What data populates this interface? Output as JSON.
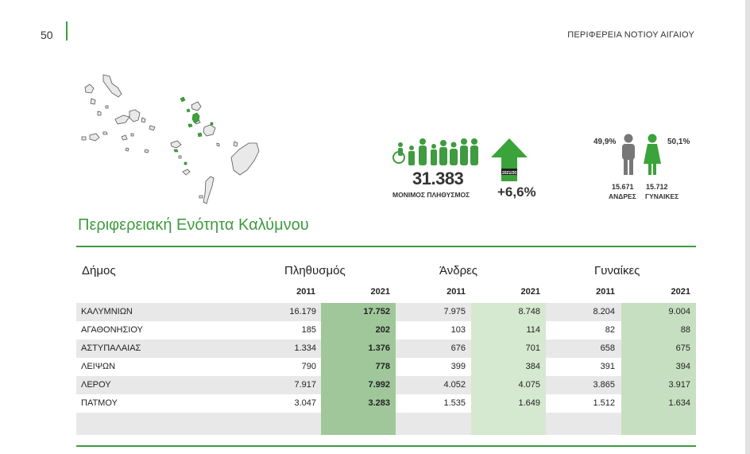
{
  "page": {
    "number": "50",
    "region": "ΠΕΡΙΦΕΡΕΙΑ ΝΟΤΙΟΥ ΑΙΓΑΙΟΥ"
  },
  "stats": {
    "total_population": "31.383",
    "total_label": "ΜΟΝΙΜΟΣ ΠΛΗΘΥΣΜΟΣ",
    "arrow_label": "2021/2011",
    "change": "+6,6%",
    "men_pct": "49,9%",
    "women_pct": "50,1%",
    "men_count": "15.671",
    "women_count": "15.712",
    "men_label": "ΑΝΔΡΕΣ",
    "women_label": "ΓΥΝΑΙΚΕΣ"
  },
  "unit_title": "Περιφερειακή Ενότητα Καλύμνου",
  "table": {
    "headers": {
      "municipality": "Δήμος",
      "population": "Πληθυσμός",
      "men": "Άνδρες",
      "women": "Γυναίκες",
      "year_2011": "2011",
      "year_2021": "2021"
    },
    "rows": [
      {
        "name": "ΚΑΛΥΜΝΙΩΝ",
        "pop2011": "16.179",
        "pop2021": "17.752",
        "men2011": "7.975",
        "men2021": "8.748",
        "women2011": "8.204",
        "women2021": "9.004"
      },
      {
        "name": "ΑΓΑΘΟΝΗΣΙΟΥ",
        "pop2011": "185",
        "pop2021": "202",
        "men2011": "103",
        "men2021": "114",
        "women2011": "82",
        "women2021": "88"
      },
      {
        "name": "ΑΣΤΥΠΑΛΑΙΑΣ",
        "pop2011": "1.334",
        "pop2021": "1.376",
        "men2011": "676",
        "men2021": "701",
        "women2011": "658",
        "women2021": "675"
      },
      {
        "name": "ΛΕΙΨΩΝ",
        "pop2011": "790",
        "pop2021": "778",
        "men2011": "399",
        "men2021": "384",
        "women2011": "391",
        "women2021": "394"
      },
      {
        "name": "ΛΕΡΟΥ",
        "pop2011": "7.917",
        "pop2021": "7.992",
        "men2011": "4.052",
        "men2021": "4.075",
        "women2011": "3.865",
        "women2021": "3.917"
      },
      {
        "name": "ΠΑΤΜΟΥ",
        "pop2011": "3.047",
        "pop2021": "3.283",
        "men2011": "1.535",
        "men2021": "1.649",
        "women2011": "1.512",
        "women2021": "1.634"
      }
    ]
  },
  "colors": {
    "accent": "#3f9b3f",
    "pop2021_bg": "#9fc79a",
    "men2021_bg": "#d5e8d0",
    "women2021_bg": "#c7dfc1",
    "row_grey": "#e8e8e8"
  }
}
